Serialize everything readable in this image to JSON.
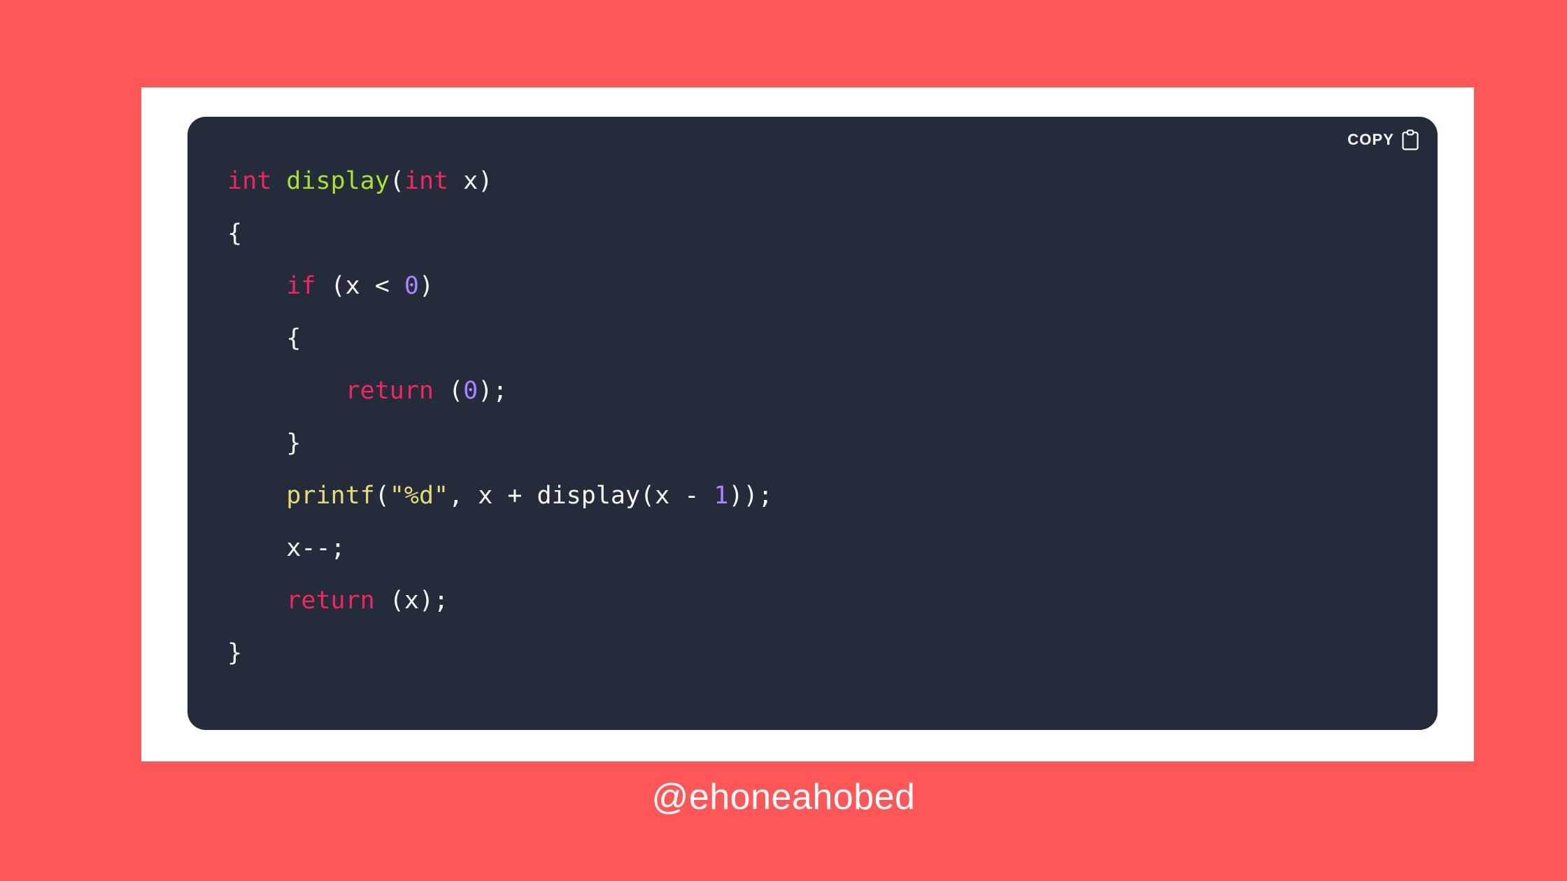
{
  "theme": {
    "page_background": "#ff5757",
    "card_background": "#ffffff",
    "code_background": "#242b3a",
    "text_default": "#f8f8f2",
    "keyword_color": "#f4245e",
    "function_color": "#a6e22e",
    "number_color": "#ae81ff",
    "string_color": "#e6db74",
    "watermark_color": "#ffffff"
  },
  "toolbar": {
    "copy_label": "COPY",
    "clipboard_icon": "clipboard-icon"
  },
  "code": {
    "language": "c",
    "lines": [
      {
        "indent": 0,
        "tokens": [
          {
            "t": "int",
            "c": "tok-key"
          },
          {
            "t": " ",
            "c": "tok-plain"
          },
          {
            "t": "display",
            "c": "tok-fn"
          },
          {
            "t": "(",
            "c": "tok-plain"
          },
          {
            "t": "int",
            "c": "tok-key"
          },
          {
            "t": " x)",
            "c": "tok-plain"
          }
        ]
      },
      {
        "indent": 0,
        "tokens": [
          {
            "t": "{",
            "c": "tok-plain"
          }
        ]
      },
      {
        "indent": 1,
        "tokens": [
          {
            "t": "if",
            "c": "tok-key"
          },
          {
            "t": " (x < ",
            "c": "tok-plain"
          },
          {
            "t": "0",
            "c": "tok-num"
          },
          {
            "t": ")",
            "c": "tok-plain"
          }
        ]
      },
      {
        "indent": 1,
        "tokens": [
          {
            "t": "{",
            "c": "tok-plain"
          }
        ]
      },
      {
        "indent": 2,
        "tokens": [
          {
            "t": "return",
            "c": "tok-key"
          },
          {
            "t": " (",
            "c": "tok-plain"
          },
          {
            "t": "0",
            "c": "tok-num"
          },
          {
            "t": ");",
            "c": "tok-plain"
          }
        ]
      },
      {
        "indent": 1,
        "tokens": [
          {
            "t": "}",
            "c": "tok-plain"
          }
        ]
      },
      {
        "indent": 1,
        "tokens": [
          {
            "t": "printf",
            "c": "tok-call"
          },
          {
            "t": "(",
            "c": "tok-plain"
          },
          {
            "t": "\"%d\"",
            "c": "tok-str"
          },
          {
            "t": ", x + display(x - ",
            "c": "tok-plain"
          },
          {
            "t": "1",
            "c": "tok-num"
          },
          {
            "t": "));",
            "c": "tok-plain"
          }
        ]
      },
      {
        "indent": 1,
        "tokens": [
          {
            "t": "x--;",
            "c": "tok-plain"
          }
        ]
      },
      {
        "indent": 1,
        "tokens": [
          {
            "t": "return",
            "c": "tok-key"
          },
          {
            "t": " (x);",
            "c": "tok-plain"
          }
        ]
      },
      {
        "indent": 0,
        "tokens": [
          {
            "t": "}",
            "c": "tok-plain"
          }
        ]
      }
    ]
  },
  "watermark": {
    "handle": "@ehoneahobed"
  }
}
